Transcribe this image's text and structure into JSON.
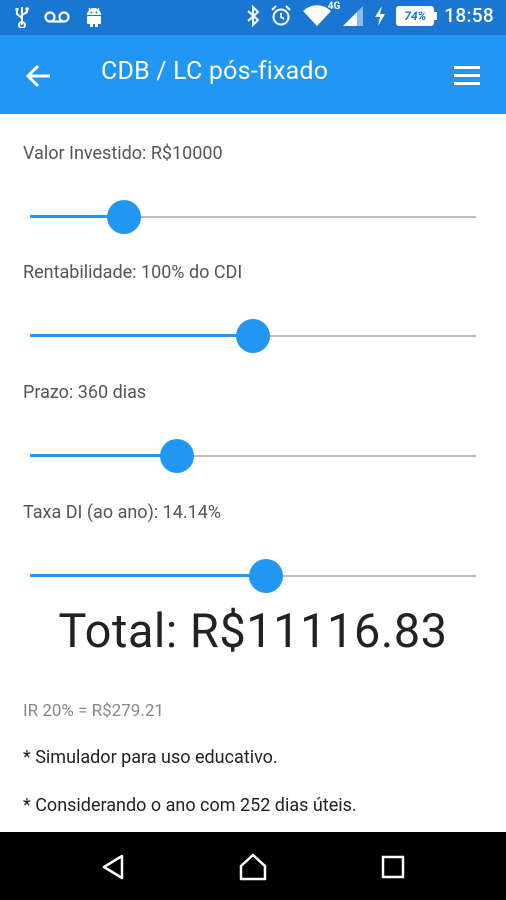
{
  "status_bar": {
    "time": "18:58",
    "battery": "74%",
    "network": "4G",
    "icons": [
      "usb-icon",
      "voicemail-icon",
      "android-icon",
      "bluetooth-icon",
      "alarm-icon",
      "wifi-icon",
      "signal-icon",
      "charging-icon",
      "battery-icon"
    ]
  },
  "app_bar": {
    "title": "CDB / LC pós-fixado",
    "back_icon": "arrow-back-icon",
    "menu_icon": "hamburger-menu-icon"
  },
  "form": {
    "valor": {
      "label": "Valor Investido: R$10000",
      "level": 0.21
    },
    "rentabilidade": {
      "label": "Rentabilidade: 100% do CDI",
      "level": 0.5
    },
    "prazo": {
      "label": "Prazo: 360 dias",
      "level": 0.33
    },
    "taxa": {
      "label": "Taxa DI (ao ano): 14.14%",
      "level": 0.53
    }
  },
  "result": {
    "total": "Total: R$11116.83",
    "ir": "IR 20% = R$279.21"
  },
  "notes": {
    "note1": "* Simulador para uso educativo.",
    "note2": "* Considerando o ano com 252 dias úteis."
  },
  "colors": {
    "status_bar": "#1976d2",
    "app_bar": "#2196f3",
    "accent": "#2196f3"
  }
}
